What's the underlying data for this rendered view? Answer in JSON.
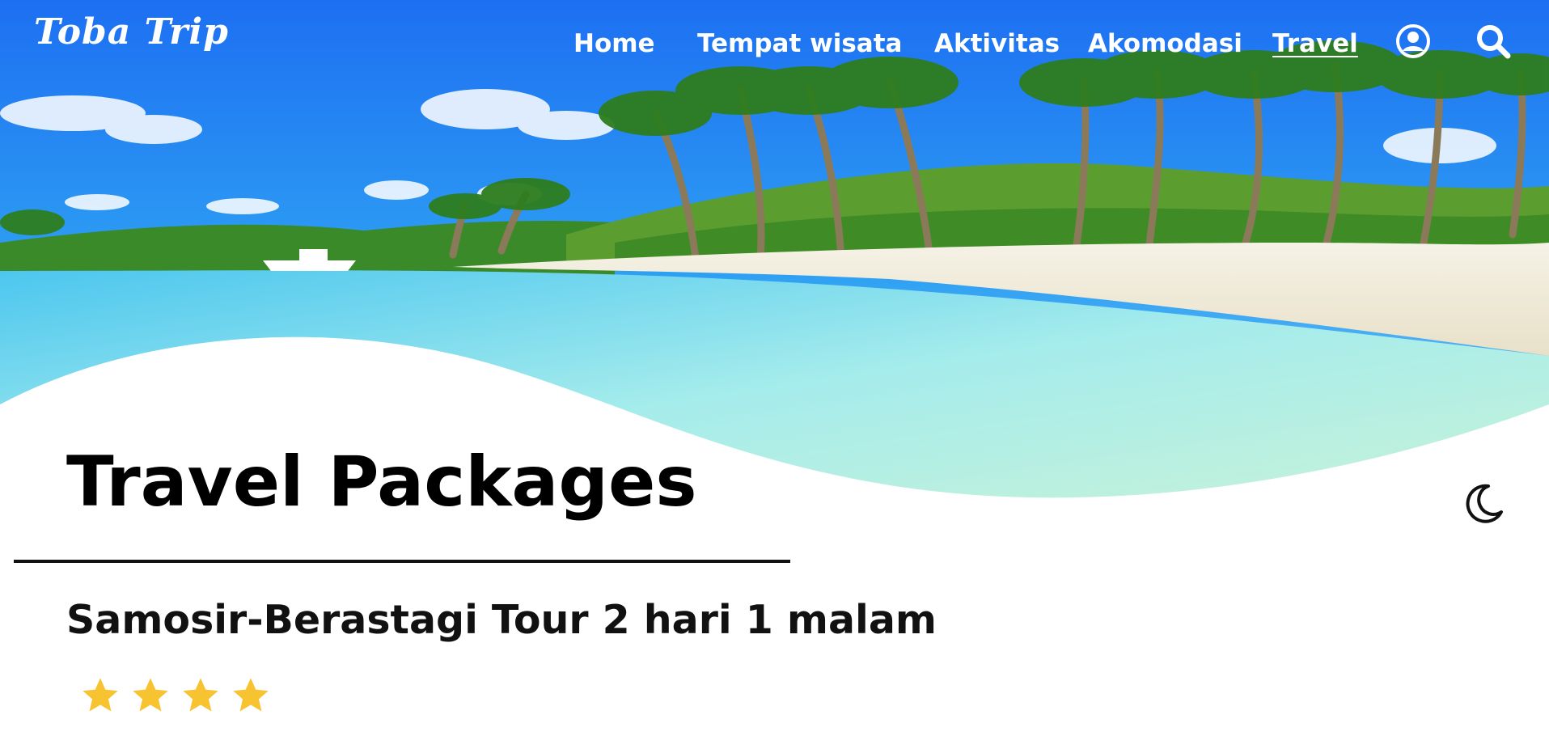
{
  "brand": {
    "name": "Toba Trip"
  },
  "nav": {
    "items": [
      {
        "label": "Home",
        "active": false
      },
      {
        "label": "Tempat wisata",
        "active": false
      },
      {
        "label": "Aktivitas",
        "active": false
      },
      {
        "label": "Akomodasi",
        "active": false
      },
      {
        "label": "Travel",
        "active": true
      }
    ],
    "icons": [
      "user-icon",
      "search-icon"
    ]
  },
  "hero": {
    "image": "tropical-beach-photo"
  },
  "main": {
    "title": "Travel Packages",
    "package": {
      "title": "Samosir-Berastagi Tour 2 hari 1 malam",
      "rating": 4
    }
  },
  "theme_toggle": {
    "icon": "moon-icon"
  },
  "colors": {
    "star": "#F7C331",
    "sky": "#1f8bf0",
    "sea": "#9fe5e8",
    "text": "#111111"
  }
}
